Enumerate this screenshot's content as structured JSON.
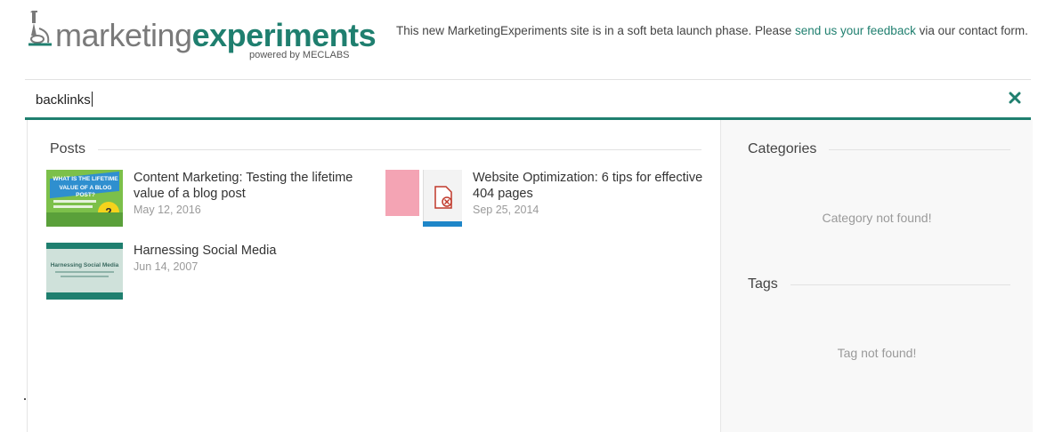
{
  "brand": {
    "name_part1": "marketing",
    "name_part2": "experiments",
    "tagline": "powered by MECLABS",
    "colors": {
      "accent": "#1f7f6f",
      "grey": "#7a7a7a"
    }
  },
  "notice": {
    "text_before": "This new MarketingExperiments site is in a soft beta launch phase. Please ",
    "link_text": "send us your feedback",
    "text_after": " via our contact form."
  },
  "search": {
    "value": "backlinks",
    "clear_icon": "close-icon"
  },
  "posts": {
    "heading": "Posts",
    "items": [
      {
        "title": "Content Marketing: Testing the lifetime value of a blog post",
        "date": "May 12, 2016",
        "thumb_text": [
          "WHAT IS THE LIFETIME",
          "VALUE OF A BLOG POST?"
        ],
        "thumb_badge": "2"
      },
      {
        "title": "Website Optimization: 6 tips for effective 404 pages",
        "date": "Sep 25, 2014"
      },
      {
        "title": "Harnessing Social Media",
        "date": "Jun 14, 2007",
        "thumb_text": [
          "Harnessing Social Media"
        ]
      }
    ]
  },
  "categories": {
    "heading": "Categories",
    "empty": "Category not found!"
  },
  "tags": {
    "heading": "Tags",
    "empty": "Tag not found!"
  }
}
